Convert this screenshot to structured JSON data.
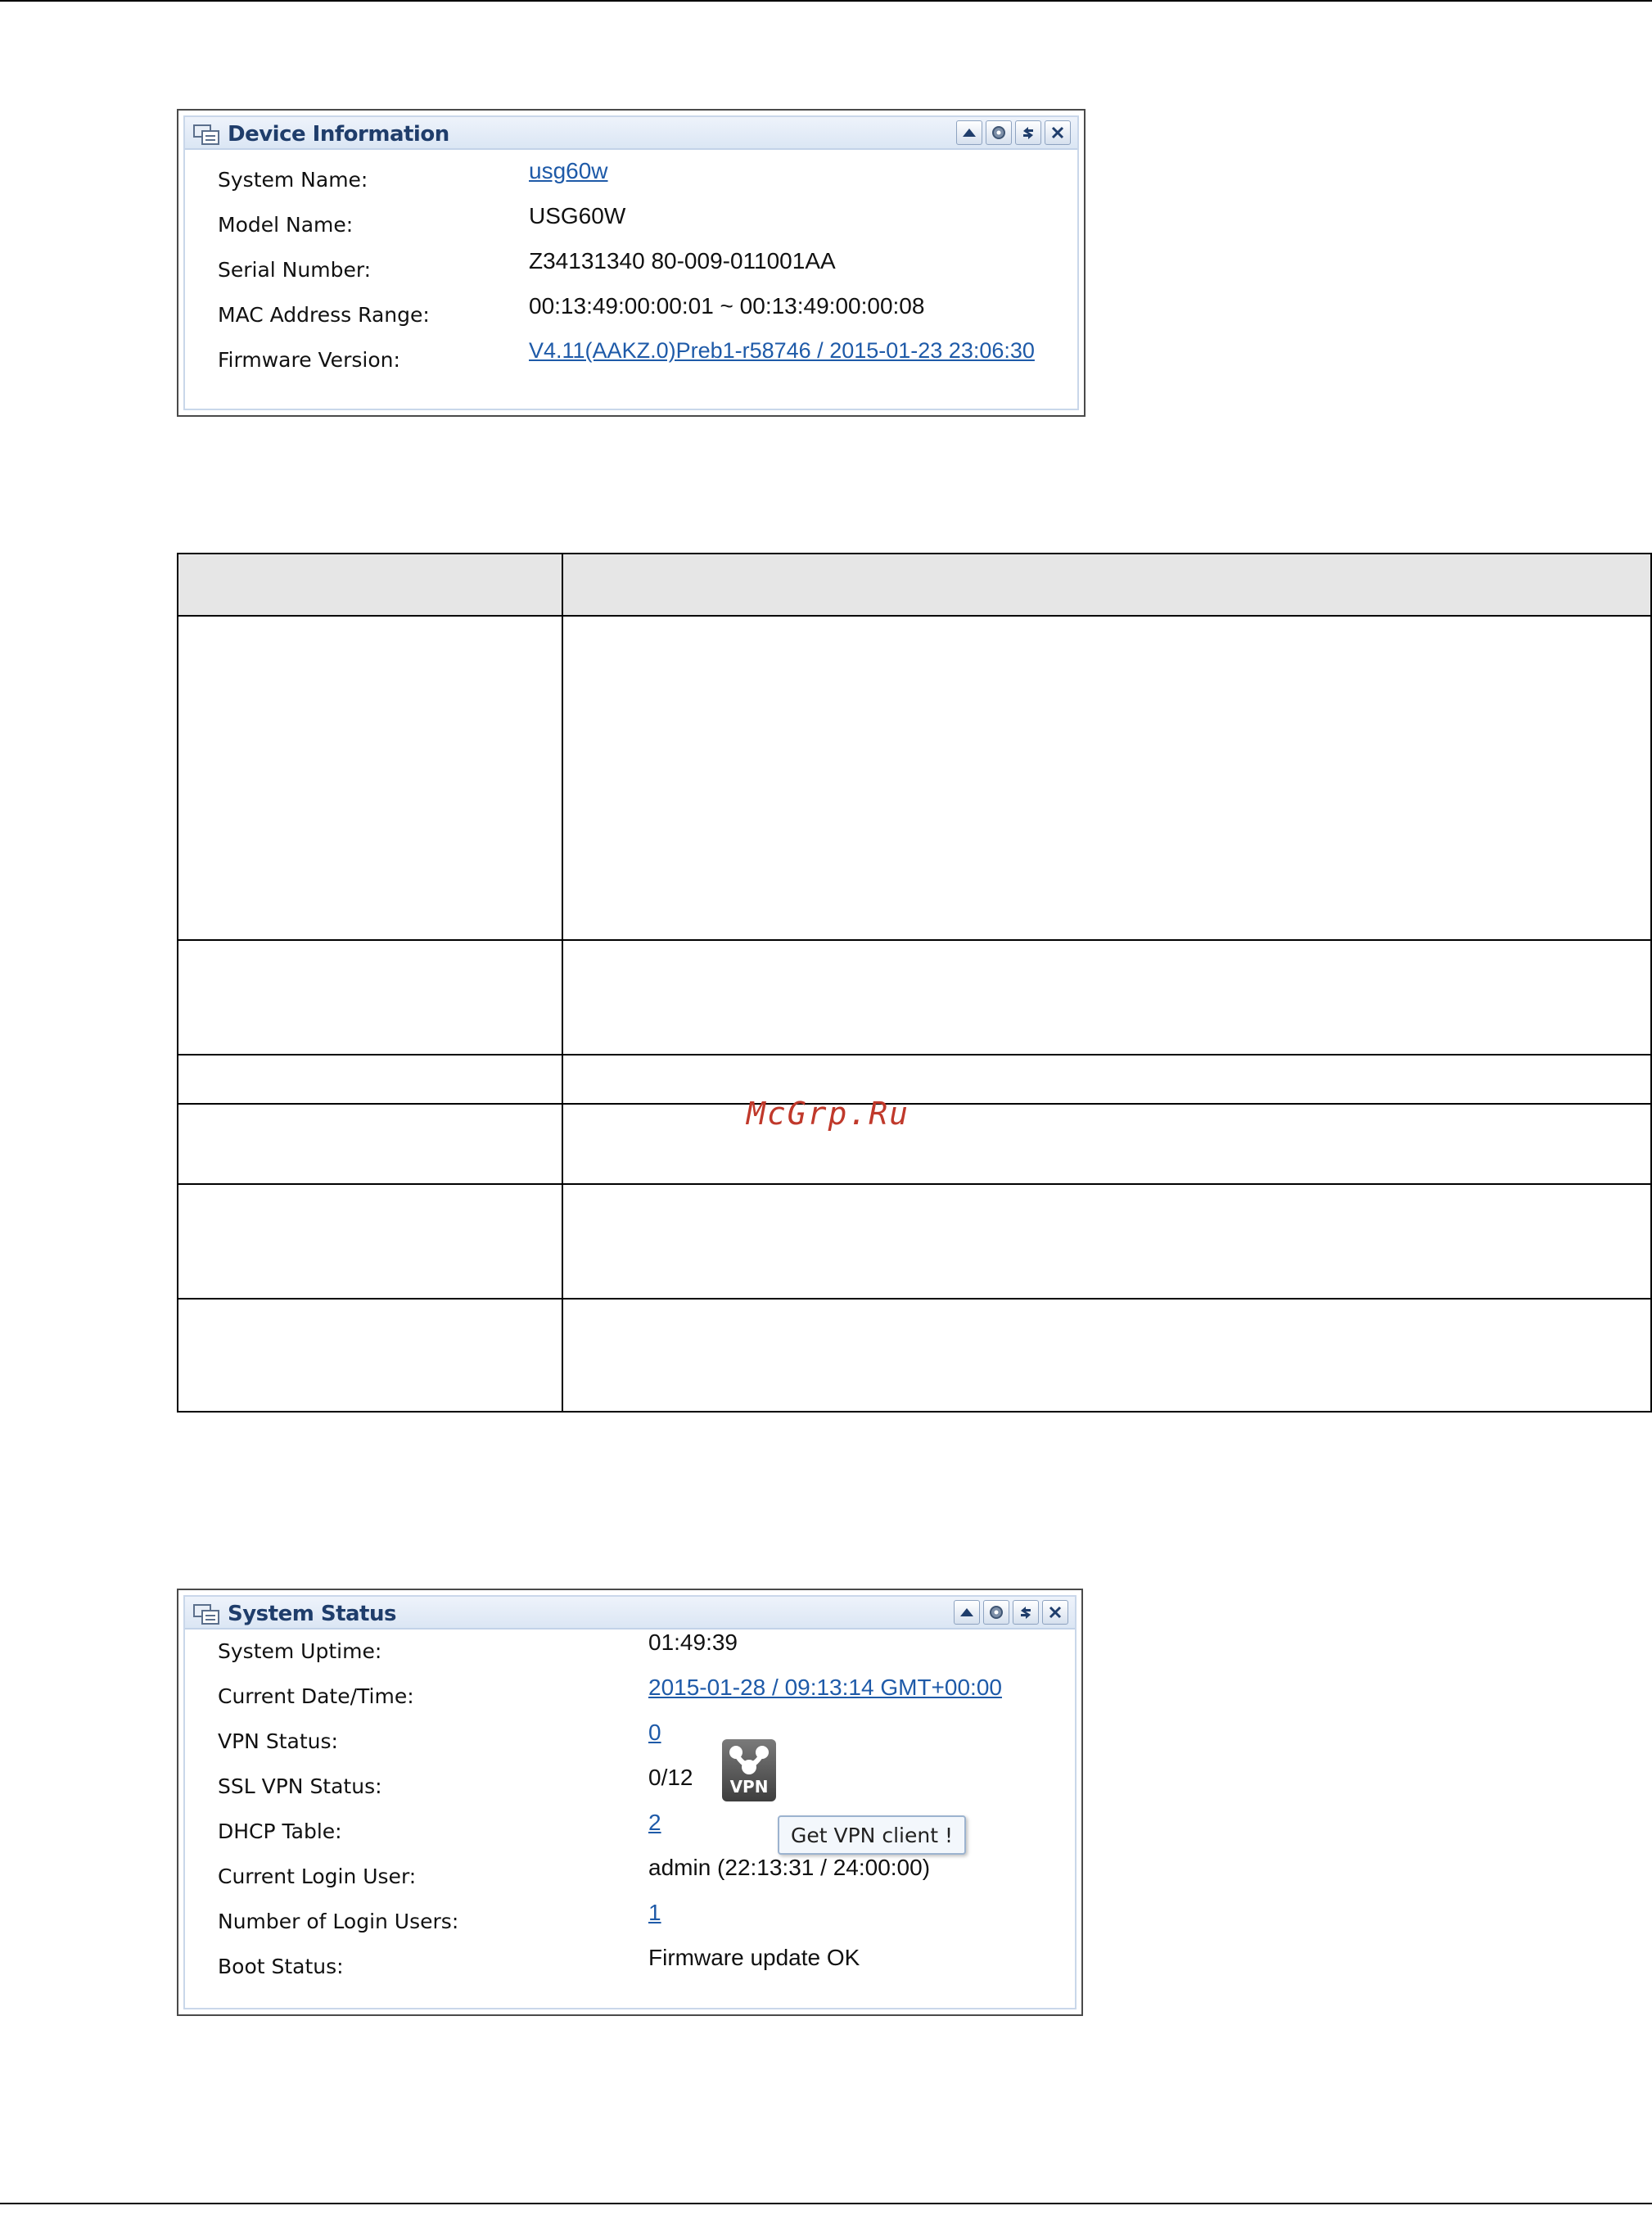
{
  "device_information": {
    "title": "Device Information",
    "rows": [
      {
        "label": "System Name:",
        "value": "usg60w",
        "link": true
      },
      {
        "label": "Model Name:",
        "value": "USG60W",
        "link": false
      },
      {
        "label": "Serial Number:",
        "value": "Z34131340 80-009-011001AA",
        "link": false
      },
      {
        "label": "MAC Address Range:",
        "value": "00:13:49:00:00:01 ~ 00:13:49:00:00:08",
        "link": false
      },
      {
        "label": "Firmware Version:",
        "value": "V4.11(AAKZ.0)Preb1-r58746 / 2015-01-23 23:06:30",
        "link": true
      }
    ],
    "tools": [
      "collapse-icon",
      "settings-icon",
      "refresh-icon",
      "close-icon"
    ]
  },
  "system_status": {
    "title": "System Status",
    "rows": [
      {
        "label": "System Uptime:",
        "value": "01:49:39",
        "link": false
      },
      {
        "label": "Current Date/Time:",
        "value": "2015-01-28 / 09:13:14 GMT+00:00",
        "link": true
      },
      {
        "label": "VPN Status:",
        "value": "0",
        "link": true
      },
      {
        "label": "SSL VPN Status:",
        "value": "0/12",
        "link": false
      },
      {
        "label": "DHCP Table:",
        "value": "2",
        "link": true
      },
      {
        "label": "Current Login User:",
        "value": "admin (22:13:31 / 24:00:00)",
        "link": false
      },
      {
        "label": "Number of Login Users:",
        "value": "1",
        "link": true
      },
      {
        "label": "Boot Status:",
        "value": "Firmware update OK",
        "link": false
      }
    ],
    "vpn_icon_text": "VPN",
    "tooltip": "Get VPN client !",
    "tools": [
      "collapse-icon",
      "settings-icon",
      "refresh-icon",
      "close-icon"
    ]
  },
  "watermark": "McGrp.Ru",
  "colors": {
    "link": "#1e5aa8",
    "title": "#1f3d6b",
    "header_bg": "#dbe6f4",
    "watermark": "#c0392b"
  }
}
